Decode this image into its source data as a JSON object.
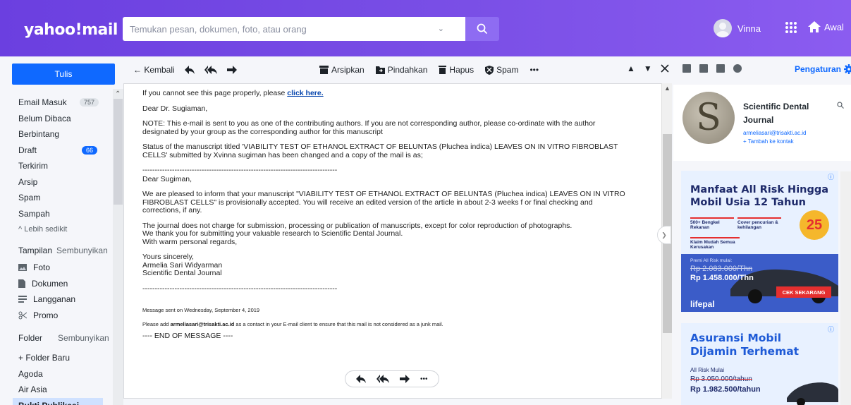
{
  "header": {
    "logo": "yahoo!mail",
    "search_placeholder": "Temukan pesan, dokumen, foto, atau orang",
    "user_name": "Vinna",
    "home_label": "Awal",
    "accent": "#6b3fe0"
  },
  "sidebar": {
    "compose_label": "Tulis",
    "items": [
      {
        "label": "Email Masuk",
        "count": "757"
      },
      {
        "label": "Belum Dibaca",
        "count": ""
      },
      {
        "label": "Berbintang",
        "count": ""
      },
      {
        "label": "Draft",
        "count": "66"
      },
      {
        "label": "Terkirim",
        "count": ""
      },
      {
        "label": "Arsip",
        "count": ""
      },
      {
        "label": "Spam",
        "count": ""
      },
      {
        "label": "Sampah",
        "count": ""
      }
    ],
    "less_label": "^ Lebih sedikit",
    "views_header": "Tampilan",
    "views_hide": "Sembunyikan",
    "views": [
      "Foto",
      "Dokumen",
      "Langganan",
      "Promo"
    ],
    "folders_header": "Folder",
    "folders_hide": "Sembunyikan",
    "new_folder": "+ Folder Baru",
    "folders": [
      "Agoda",
      "Air Asia",
      "Bukti Publikasi"
    ]
  },
  "toolbar": {
    "back": "← Kembali",
    "archive": "Arsipkan",
    "move": "Pindahkan",
    "delete": "Hapus",
    "spam": "Spam",
    "more": "•••"
  },
  "mail": {
    "line1_prefix": "If you cannot see this page properly, please ",
    "line1_link": "click here.",
    "greeting": "Dear Dr. Sugiaman,",
    "note": "NOTE: This e-mail is sent to you as one of the contributing authors. If you are not corresponding author, please co-ordinate with the author\ndesignated by your group as the corresponding author for this manuscript",
    "status": "Status of the manuscript titled 'VIABILITY TEST OF ETHANOL EXTRACT OF BELUNTAS (Pluchea indica) LEAVES ON IN VITRO FIBROBLAST\nCELLS' submitted by Xvinna sugiman has been changed and a copy of the mail is as;",
    "divider": "-------------------------------------------------------------------------------",
    "greeting2": "Dear Sugiman,",
    "body1": "We are pleased to inform that your manuscript \"VIABILITY TEST OF ETHANOL EXTRACT OF BELUNTAS (Pluchea indica) LEAVES ON IN VITRO\nFIBROBLAST CELLS\" is provisionally accepted. You will receive an edited version of the article in about 2-3 weeks f or final checking and\ncorrections, if any.",
    "body2": "The journal does not charge for submission, processing or publication of manuscripts, except for color reproduction of photographs.\nWe thank you for submitting your valuable research to Scientific Dental Journal.\nWith warm personal regards,",
    "sign": "Yours sincerely,\nArmelia Sari Widyarman\nScientific Dental Journal",
    "sent": "Message sent on Wednesday, September 4, 2019",
    "add_prefix": "Please add ",
    "add_email": "armeliasari@trisakti.ac.id",
    "add_suffix": " as a contact in your E-mail client to ensure that this mail is not considered as a junk mail.",
    "end": "---- END OF MESSAGE ----"
  },
  "rightpanel": {
    "settings": "Pengaturan",
    "contact_name": "Scientific Dental Journal",
    "contact_email": "armeliasari@trisakti.ac.id",
    "add_contact": "+ Tambah ke kontak",
    "avatar_letter": "S"
  },
  "ad1": {
    "title": "Manfaat All Risk Hingga Mobil Usia 12 Tahun",
    "f1": "500+ Bengkel Rekanan",
    "f2": "Cover pencurian & kehilangan",
    "f3": "Klaim Mudah Semua Kerusakan",
    "premi": "Premi All Risk mulai:",
    "old_price": "Rp 2.083.000/Thn",
    "new_price": "Rp 1.458.000/Thn",
    "cta": "CEK SEKARANG",
    "brand": "lifepal",
    "badge": "25"
  },
  "ad2": {
    "title": "Asuransi Mobil Dijamin Terhemat",
    "sub": "All Risk Mulai",
    "old_price": "Rp 3.050.000/tahun",
    "new_price": "Rp 1.982.500/tahun"
  }
}
